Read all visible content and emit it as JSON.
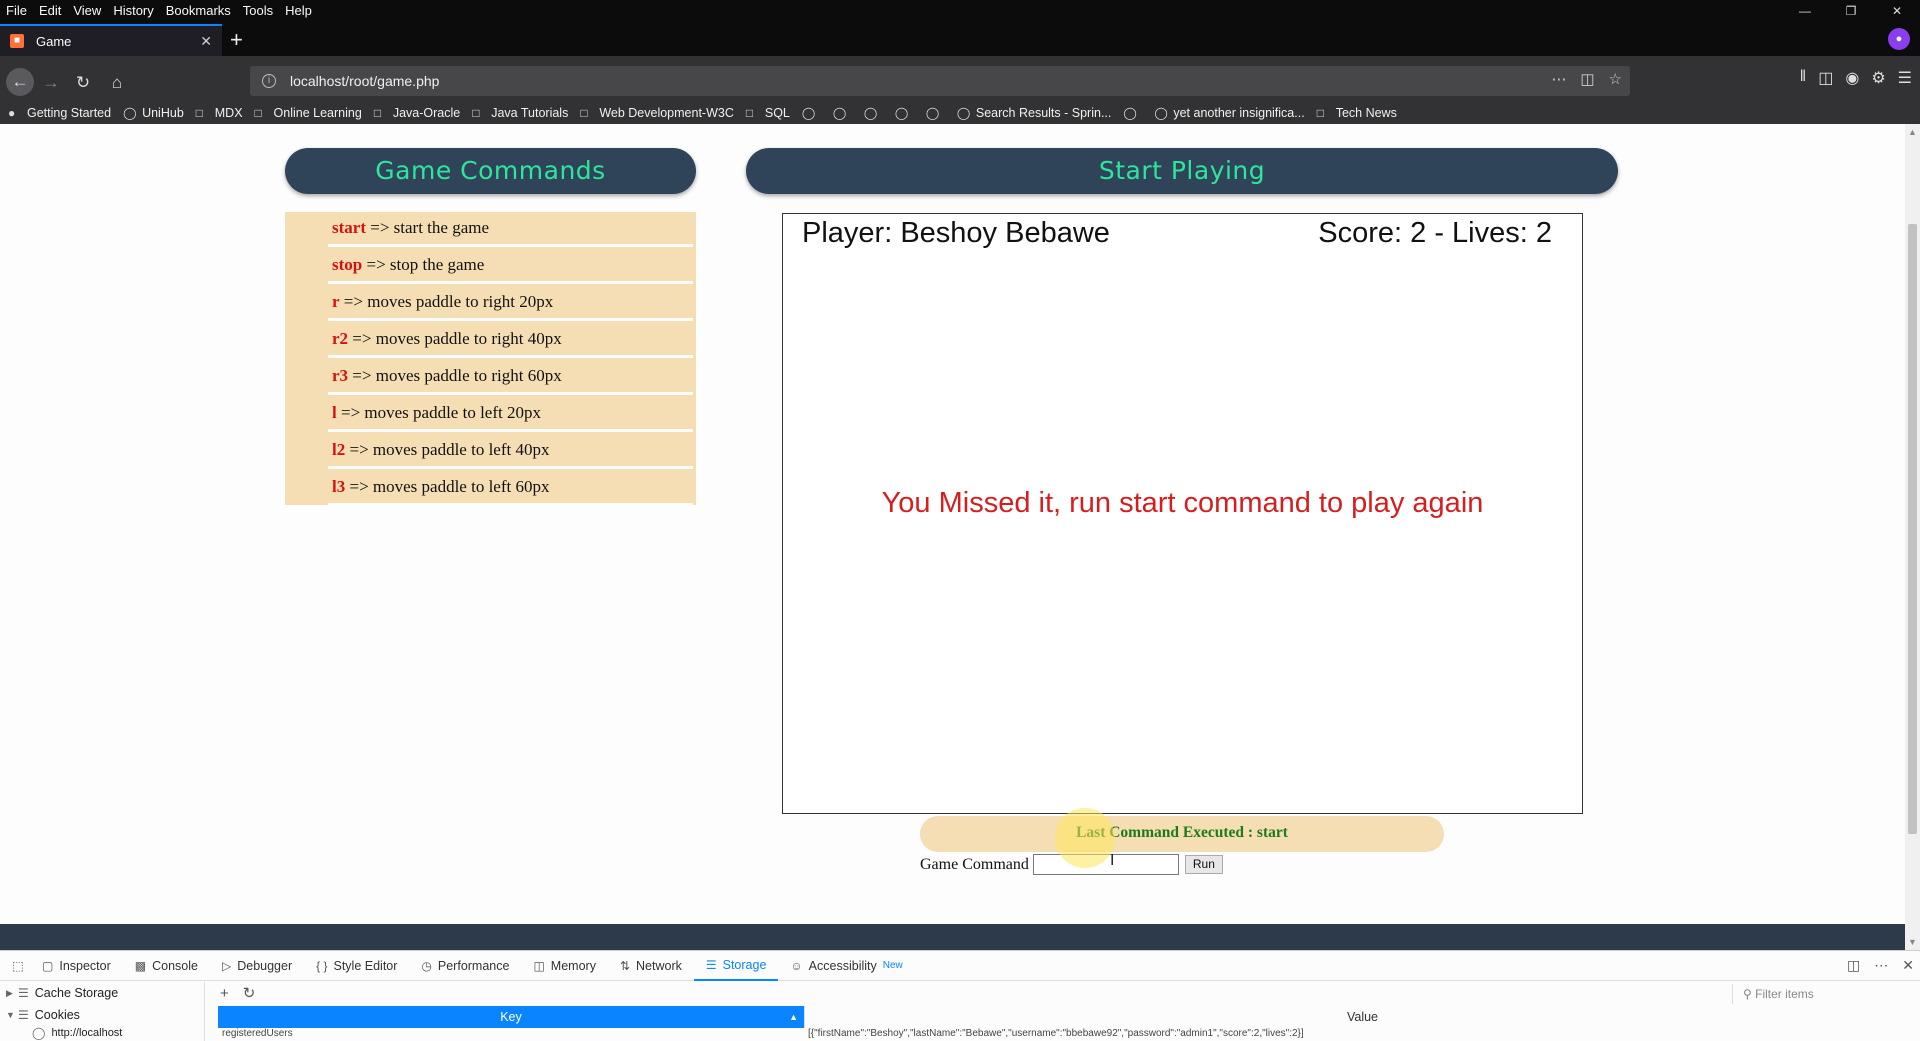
{
  "menubar": {
    "items": [
      "File",
      "Edit",
      "View",
      "History",
      "Bookmarks",
      "Tools",
      "Help"
    ]
  },
  "tab": {
    "title": "Game"
  },
  "navbar": {
    "url": "localhost/root/game.php"
  },
  "bookmarks": [
    {
      "label": "Getting Started",
      "icon": "firefox-icon"
    },
    {
      "label": "UniHub",
      "icon": "globe-icon"
    },
    {
      "label": "MDX",
      "icon": "folder-icon"
    },
    {
      "label": "Online Learning",
      "icon": "folder-icon"
    },
    {
      "label": "Java-Oracle",
      "icon": "folder-icon"
    },
    {
      "label": "Java Tutorials",
      "icon": "folder-icon"
    },
    {
      "label": "Web Development-W3C",
      "icon": "folder-icon"
    },
    {
      "label": "SQL",
      "icon": "folder-icon"
    },
    {
      "label": "",
      "icon": "globe-icon"
    },
    {
      "label": "",
      "icon": "globe-icon"
    },
    {
      "label": "",
      "icon": "globe-icon"
    },
    {
      "label": "",
      "icon": "globe-icon"
    },
    {
      "label": "",
      "icon": "globe-icon"
    },
    {
      "label": "Search Results - Sprin...",
      "icon": "globe-icon"
    },
    {
      "label": "",
      "icon": "globe-icon"
    },
    {
      "label": "yet another insignifica...",
      "icon": "globe-icon"
    },
    {
      "label": "Tech News",
      "icon": "folder-icon"
    }
  ],
  "page": {
    "commands_title": "Game Commands",
    "play_title": "Start Playing",
    "commands": [
      {
        "key": "start",
        "desc": " => start the game"
      },
      {
        "key": "stop",
        "desc": " => stop the game"
      },
      {
        "key": "r",
        "desc": " => moves paddle to right 20px"
      },
      {
        "key": "r2",
        "desc": " => moves paddle to right 40px"
      },
      {
        "key": "r3",
        "desc": " => moves paddle to right 60px"
      },
      {
        "key": "l",
        "desc": " => moves paddle to left 20px"
      },
      {
        "key": "l2",
        "desc": " => moves paddle to left 40px"
      },
      {
        "key": "l3",
        "desc": " => moves paddle to left 60px"
      }
    ],
    "game": {
      "player": "Player: Beshoy Bebawe",
      "score": "Score: 2 - Lives: 2",
      "message": "You Missed it, run start command to play again"
    },
    "last_command": "Last Command Executed : start",
    "command_label": "Game Command",
    "command_value": "",
    "run_label": "Run"
  },
  "devtools": {
    "tabs": [
      {
        "label": "Inspector",
        "icon": "inspector-icon"
      },
      {
        "label": "Console",
        "icon": "console-icon"
      },
      {
        "label": "Debugger",
        "icon": "debugger-icon"
      },
      {
        "label": "Style Editor",
        "icon": "style-editor-icon"
      },
      {
        "label": "Performance",
        "icon": "performance-icon"
      },
      {
        "label": "Memory",
        "icon": "memory-icon"
      },
      {
        "label": "Network",
        "icon": "network-icon"
      },
      {
        "label": "Storage",
        "icon": "storage-icon"
      },
      {
        "label": "Accessibility",
        "icon": "accessibility-icon"
      }
    ],
    "new_badge": "New",
    "tree": {
      "cache_storage": "Cache Storage",
      "cookies": "Cookies",
      "localhost": "http://localhost"
    },
    "filter_placeholder": "Filter items",
    "table": {
      "key_header": "Key",
      "value_header": "Value",
      "row_key": "registeredUsers",
      "row_value": "[{\"firstName\":\"Beshoy\",\"lastName\":\"Bebawe\",\"username\":\"bbebawe92\",\"password\":\"admin1\",\"score\":2,\"lives\":2}]"
    }
  },
  "colors": {
    "header_bg": "#2f4458",
    "header_text": "#2ee59d",
    "command_panel": "#f5deb3",
    "command_key": "#d51111",
    "game_message": "#d51f1f",
    "last_command_text": "#1f7a1f",
    "devtools_accent": "#0a84ff"
  }
}
